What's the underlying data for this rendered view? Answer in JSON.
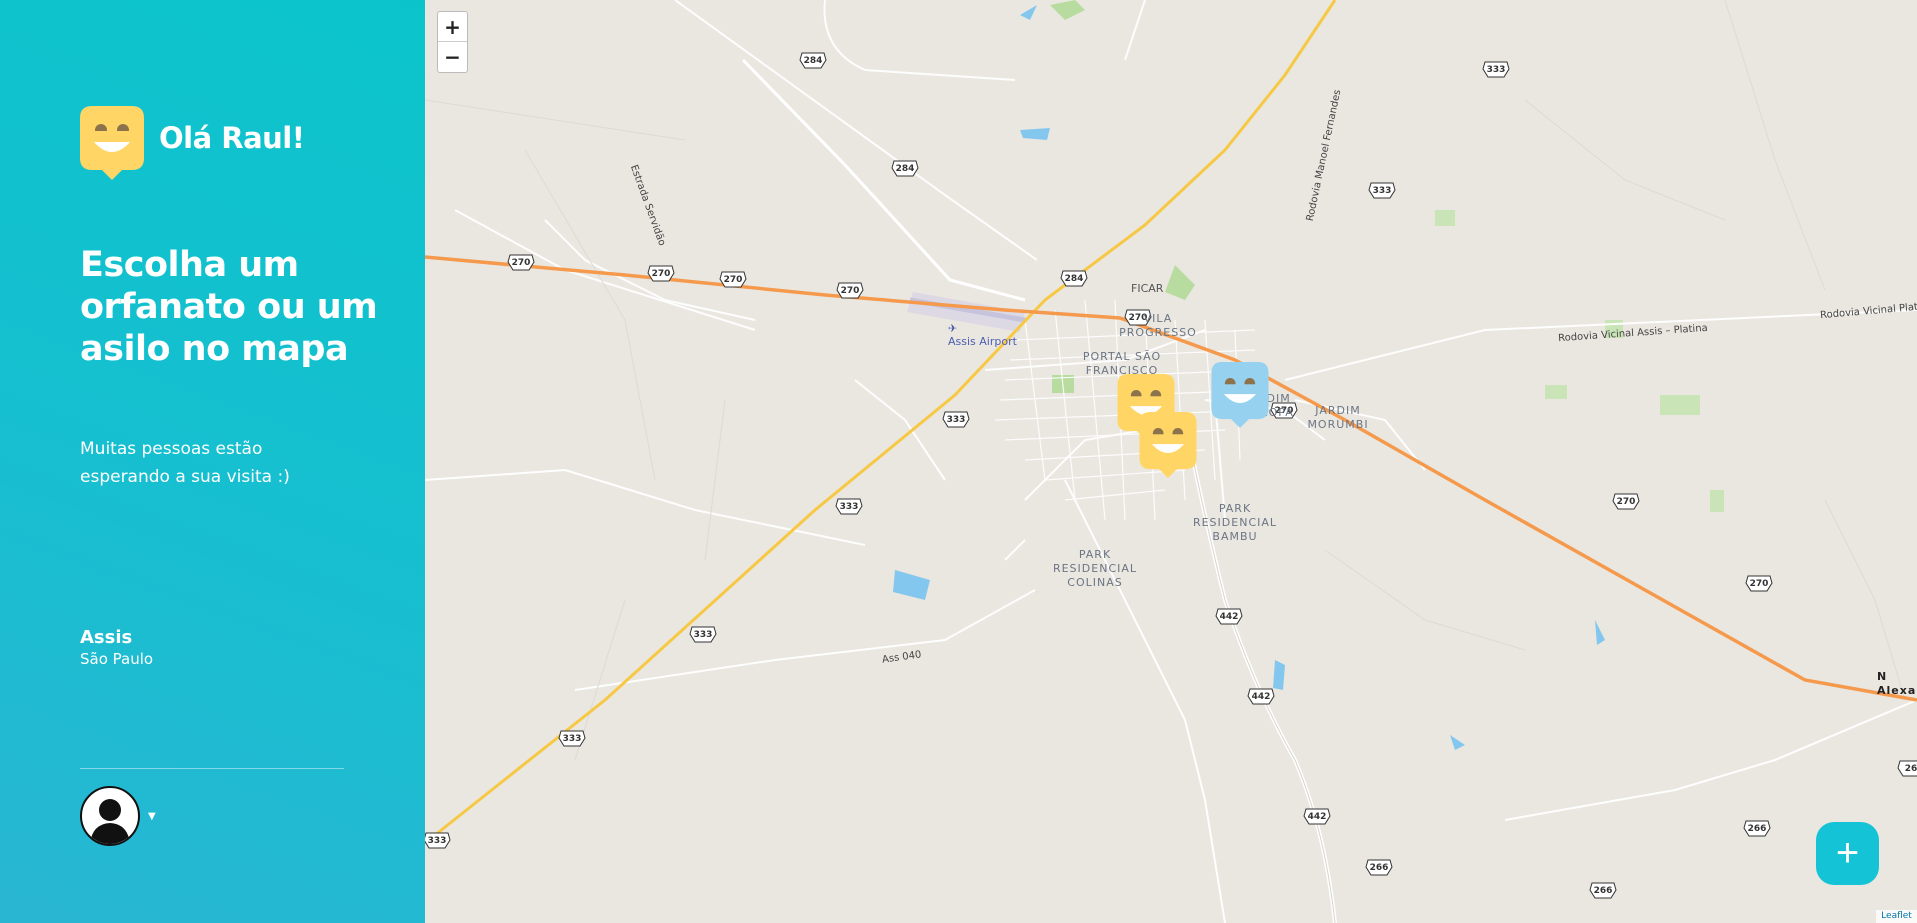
{
  "sidebar": {
    "greeting": "Olá Raul!",
    "headline": "Escolha um orfanato ou um asilo no mapa",
    "subtitle": "Muitas pessoas estão esperando a sua visita :)",
    "city": "Assis",
    "state": "São Paulo"
  },
  "map": {
    "zoom_in": "+",
    "zoom_out": "−",
    "attribution": "Leaflet",
    "airport": "Assis Airport",
    "ficar": "FICAR",
    "neighborhoods": {
      "vila_progresso": "VILA PROGRESSO",
      "portal": "PORTAL SÃO FRANCISCO",
      "jardim_europa": "JARDIM EUROPA",
      "jardim_morumbi": "JARDIM MORUMBI",
      "park_bambu": "PARK RESIDENCIAL BAMBU",
      "park_colinas": "PARK RESIDENCIAL COLINAS",
      "nova_alexandria": "N Alexa"
    },
    "roads": {
      "estrada_servidao": "Estrada Servidão",
      "rodovia_manoel": "Rodovia Manoel Fernandes",
      "vicinal_platina": "Rodovia Vicinal Assis – Platina",
      "vicinal_plat2": "Rodovia Vicinal Plat",
      "ass040": "Ass 040"
    },
    "shields": {
      "r284a": "284",
      "r284b": "284",
      "r284c": "284",
      "r270a": "270",
      "r270b": "270",
      "r270c": "270",
      "r270d": "270",
      "r270e": "270",
      "r270f": "270",
      "r270g": "270",
      "r270h": "270",
      "r333a": "333",
      "r333b": "333",
      "r333c": "333",
      "r333d": "333",
      "r333e": "333",
      "r333f": "333",
      "r333g": "333",
      "r442a": "442",
      "r442b": "442",
      "r442c": "442",
      "r266a": "266",
      "r266b": "266",
      "r266c": "266",
      "r26": "26"
    },
    "markers": [
      {
        "color": "#ffd666"
      },
      {
        "color": "#ffd666"
      },
      {
        "color": "#96d2f0"
      }
    ]
  },
  "add_button_label": "+",
  "icons": {
    "logo": "smiley-pin-icon",
    "avatar": "user-silhouette-icon",
    "caret": "caret-down-icon",
    "add": "plus-icon"
  }
}
